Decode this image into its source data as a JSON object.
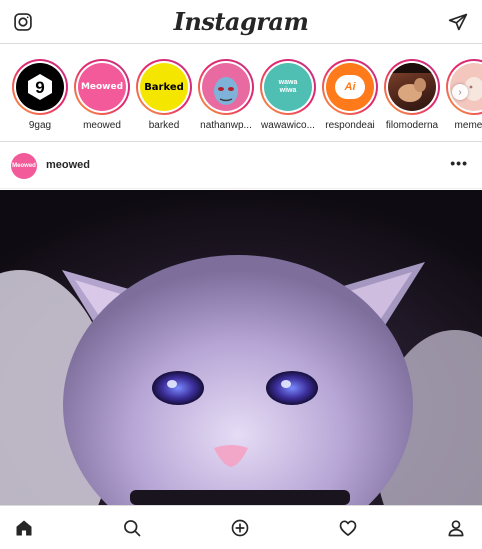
{
  "app": {
    "logo_text": "Instagram"
  },
  "topbar": {
    "left_icon": "camera-icon",
    "right_icon": "direct-message-icon"
  },
  "stories": [
    {
      "name": "9gag",
      "avatar_text": "9",
      "avatar_bg": "#000000",
      "avatar_fg": "#ffffff"
    },
    {
      "name": "meowed",
      "avatar_text": "Meowed",
      "avatar_bg": "#f35a9a",
      "avatar_fg": "#ffffff"
    },
    {
      "name": "barked",
      "avatar_text": "Barked",
      "avatar_bg": "#f5e600",
      "avatar_fg": "#000000"
    },
    {
      "name": "nathanwp...",
      "avatar_text": "",
      "avatar_bg": "#e86aa0",
      "avatar_fg": "#ffffff"
    },
    {
      "name": "wawawico...",
      "avatar_text": "wawa wiwa",
      "avatar_bg": "#4fbfb3",
      "avatar_fg": "#ffffff"
    },
    {
      "name": "respondeai",
      "avatar_text": "Ai",
      "avatar_bg": "#ff7a1a",
      "avatar_fg": "#ffffff"
    },
    {
      "name": "filomoderna",
      "avatar_text": "",
      "avatar_bg": "#5a2c1e",
      "avatar_fg": "#ffffff"
    },
    {
      "name": "memeria",
      "avatar_text": "",
      "avatar_bg": "#f3c6be",
      "avatar_fg": "#ffffff"
    }
  ],
  "post": {
    "username": "meowed",
    "avatar_text": "Meowed",
    "more_label": "•••",
    "image_subject": "cat"
  },
  "bottom_nav": [
    {
      "name": "home-icon"
    },
    {
      "name": "search-icon"
    },
    {
      "name": "new-post-icon"
    },
    {
      "name": "activity-heart-icon"
    },
    {
      "name": "profile-icon"
    }
  ],
  "colors": {
    "story_ring_start": "#f9a33a",
    "story_ring_end": "#c13584",
    "text": "#262626",
    "border": "#dbdbdb"
  }
}
